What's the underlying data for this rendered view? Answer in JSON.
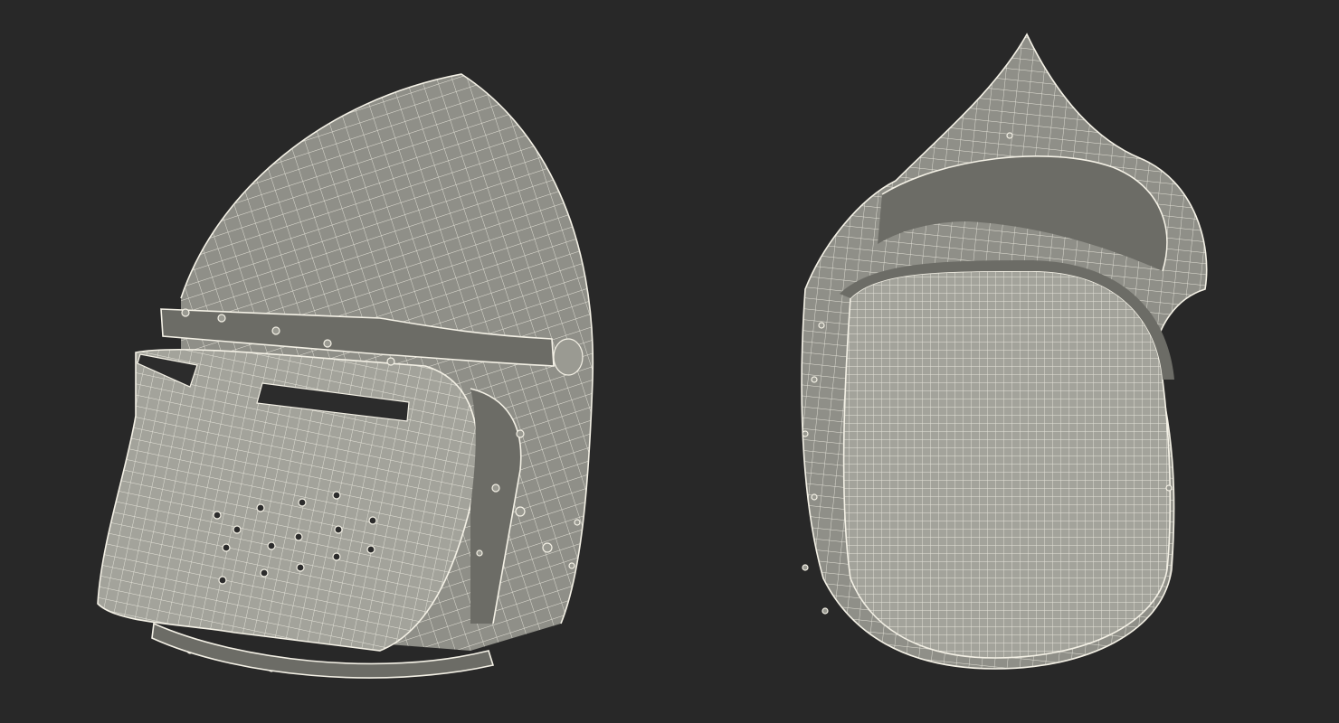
{
  "background_color": "#282828",
  "mesh_color": "#f4f1e6",
  "surface_color": "#8f8f88",
  "views": [
    {
      "name": "helmet-front-three-quarter",
      "subject": "bascinet-helmet-with-visor"
    },
    {
      "name": "helmet-interior-view",
      "subject": "bascinet-helmet-shell-interior"
    }
  ]
}
